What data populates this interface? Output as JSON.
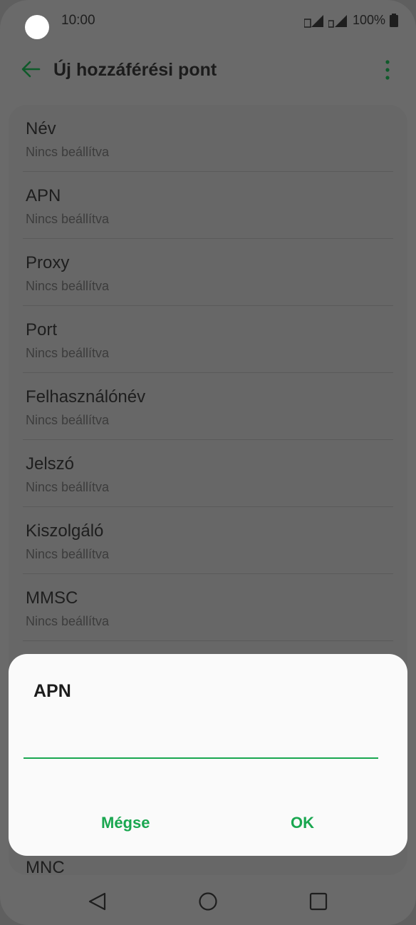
{
  "status_bar": {
    "time": "10:00",
    "battery": "100%"
  },
  "app_bar": {
    "title": "Új hozzáférési pont"
  },
  "list": {
    "items": [
      {
        "label": "Név",
        "value": "Nincs beállítva"
      },
      {
        "label": "APN",
        "value": "Nincs beállítva"
      },
      {
        "label": "Proxy",
        "value": "Nincs beállítva"
      },
      {
        "label": "Port",
        "value": "Nincs beállítva"
      },
      {
        "label": "Felhasználónév",
        "value": "Nincs beállítva"
      },
      {
        "label": "Jelszó",
        "value": "Nincs beállítva"
      },
      {
        "label": "Kiszolgáló",
        "value": "Nincs beállítva"
      },
      {
        "label": "MMSC",
        "value": "Nincs beállítva"
      }
    ],
    "partial_item_label": "MNC"
  },
  "dialog": {
    "title": "APN",
    "input_value": "",
    "cancel_label": "Mégse",
    "ok_label": "OK"
  },
  "colors": {
    "accent": "#1aa750",
    "dialog_bg": "#fafafa",
    "dim_bg": "#6a6a6a"
  },
  "icons": {
    "back": "arrow-left-icon",
    "more": "more-vertical-icon",
    "nav_back": "triangle-back-icon",
    "nav_home": "circle-home-icon",
    "nav_recents": "square-recents-icon"
  }
}
